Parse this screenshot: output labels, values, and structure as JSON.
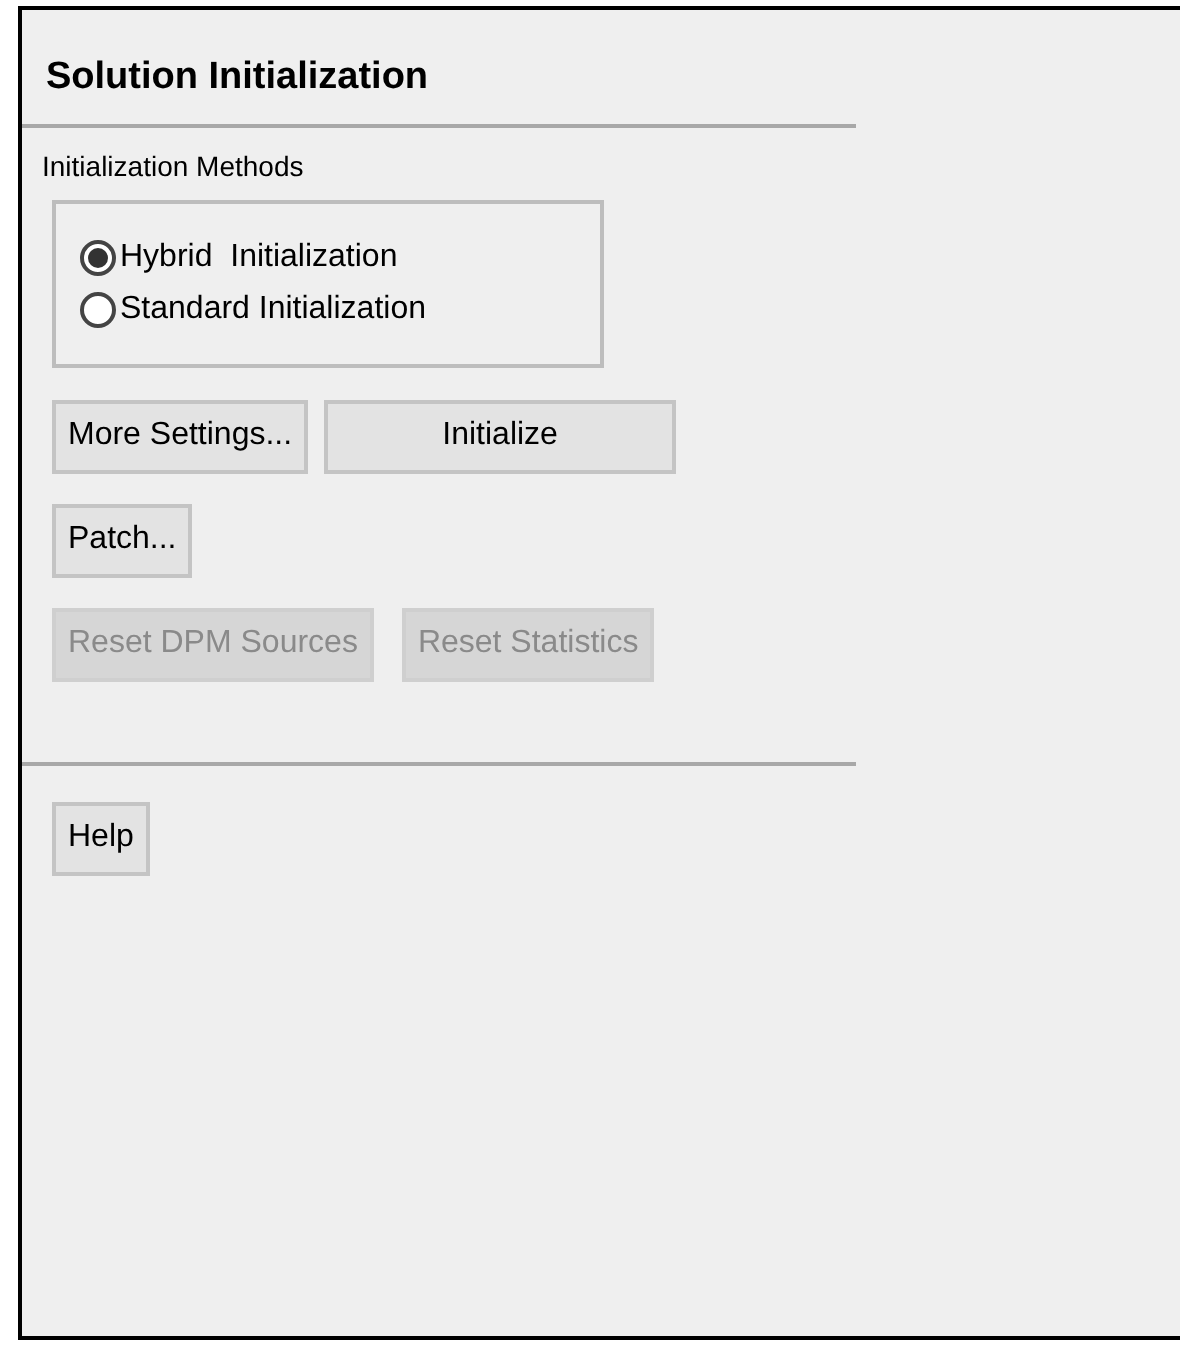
{
  "panel": {
    "title": "Solution Initialization"
  },
  "initialization_methods": {
    "label": "Initialization Methods",
    "options": [
      {
        "label": "Hybrid  Initialization",
        "selected": true
      },
      {
        "label": "Standard Initialization",
        "selected": false
      }
    ]
  },
  "button_rows": [
    [
      {
        "label": "More Settings...",
        "disabled": false,
        "wide": false
      },
      {
        "label": "Initialize",
        "disabled": false,
        "wide": true
      }
    ],
    [
      {
        "label": "Patch...",
        "disabled": false,
        "wide": false
      }
    ],
    [
      {
        "label": "Reset DPM Sources",
        "disabled": true,
        "wide": false
      },
      {
        "label": "Reset Statistics",
        "disabled": true,
        "wide": false
      }
    ]
  ],
  "help_button": {
    "label": "Help",
    "disabled": false
  }
}
